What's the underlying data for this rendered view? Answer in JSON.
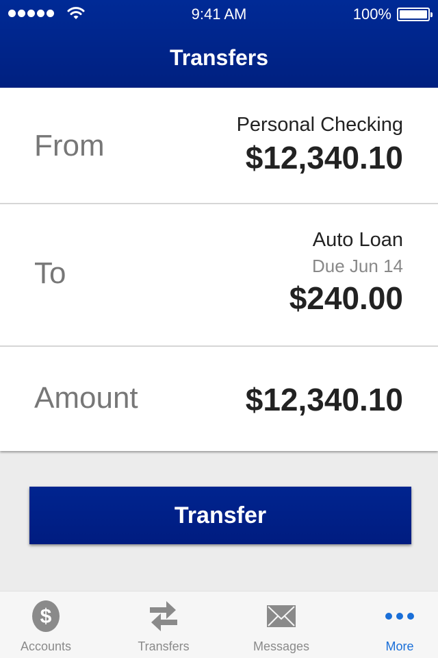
{
  "status_bar": {
    "time": "9:41 AM",
    "battery_percent": "100%",
    "signal_bars": 5
  },
  "header": {
    "title": "Transfers"
  },
  "transfer_form": {
    "from": {
      "label": "From",
      "account_name": "Personal Checking",
      "balance": "$12,340.10"
    },
    "to": {
      "label": "To",
      "account_name": "Auto Loan",
      "due": "Due Jun 14",
      "amount": "$240.00"
    },
    "amount": {
      "label": "Amount",
      "value": "$12,340.10"
    }
  },
  "actions": {
    "transfer_label": "Transfer"
  },
  "tabbar": {
    "active_color": "#1a6fd8",
    "inactive_color": "#8a8a8a",
    "items": [
      {
        "label": "Accounts",
        "icon": "dollar-circle-icon",
        "active": false
      },
      {
        "label": "Transfers",
        "icon": "transfer-arrows-icon",
        "active": false
      },
      {
        "label": "Messages",
        "icon": "envelope-icon",
        "active": false
      },
      {
        "label": "More",
        "icon": "more-dots-icon",
        "active": true
      }
    ]
  },
  "colors": {
    "brand_blue": "#002a96",
    "background": "#ececec"
  }
}
